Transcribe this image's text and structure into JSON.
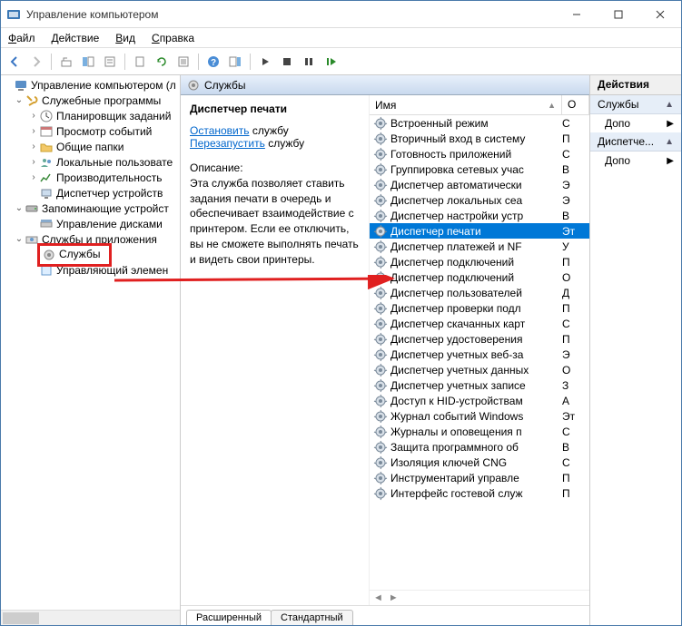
{
  "window": {
    "title": "Управление компьютером"
  },
  "menu": {
    "file": "Файл",
    "action": "Действие",
    "view": "Вид",
    "help": "Справка"
  },
  "tree": {
    "root": "Управление компьютером (л",
    "utilities": "Служебные программы",
    "scheduler": "Планировщик заданий",
    "eventviewer": "Просмотр событий",
    "sharedfolders": "Общие папки",
    "localusers": "Локальные пользовате",
    "performance": "Производительность",
    "devmgr": "Диспетчер устройств",
    "storage": "Запоминающие устройст",
    "diskmgr": "Управление дисками",
    "servicesapps": "Службы и приложения",
    "services": "Службы",
    "wmi": "Управляющий элемен"
  },
  "mid": {
    "header": "Службы",
    "selected_title": "Диспетчер печати",
    "stop_link": "Остановить",
    "stop_suffix": " службу",
    "restart_link": "Перезапустить",
    "restart_suffix": " службу",
    "desc_label": "Описание:",
    "desc_text": "Эта служба позволяет ставить задания печати в очередь и обеспечивает взаимодействие с принтером. Если ее отключить, вы не сможете выполнять печать и видеть свои принтеры."
  },
  "list": {
    "col_name": "Имя",
    "col_o": "О",
    "items": [
      {
        "name": "Встроенный режим",
        "o": "С"
      },
      {
        "name": "Вторичный вход в систему",
        "o": "П"
      },
      {
        "name": "Готовность приложений",
        "o": "С"
      },
      {
        "name": "Группировка сетевых учас",
        "o": "В"
      },
      {
        "name": "Диспетчер автоматически",
        "o": "Э"
      },
      {
        "name": "Диспетчер локальных сеа",
        "o": "Э"
      },
      {
        "name": "Диспетчер настройки устр",
        "o": "В"
      },
      {
        "name": "Диспетчер печати",
        "o": "Эт",
        "selected": true
      },
      {
        "name": "Диспетчер платежей и NF",
        "o": "У"
      },
      {
        "name": "Диспетчер подключений",
        "o": "П"
      },
      {
        "name": "Диспетчер подключений",
        "o": "О"
      },
      {
        "name": "Диспетчер пользователей",
        "o": "Д"
      },
      {
        "name": "Диспетчер проверки подл",
        "o": "П"
      },
      {
        "name": "Диспетчер скачанных карт",
        "o": "С"
      },
      {
        "name": "Диспетчер удостоверения",
        "o": "П"
      },
      {
        "name": "Диспетчер учетных веб-за",
        "o": "Э"
      },
      {
        "name": "Диспетчер учетных данных",
        "o": "О"
      },
      {
        "name": "Диспетчер учетных записе",
        "o": "З"
      },
      {
        "name": "Доступ к HID-устройствам",
        "o": "А"
      },
      {
        "name": "Журнал событий Windows",
        "o": "Эт"
      },
      {
        "name": "Журналы и оповещения п",
        "o": "С"
      },
      {
        "name": "Защита программного об",
        "o": "В"
      },
      {
        "name": "Изоляция ключей CNG",
        "o": "С"
      },
      {
        "name": "Инструментарий управле",
        "o": "П"
      },
      {
        "name": "Интерфейс гостевой служ",
        "o": "П"
      }
    ]
  },
  "tabs": {
    "ext": "Расширенный",
    "std": "Стандартный"
  },
  "actions": {
    "header": "Действия",
    "s1": "Службы",
    "i1": "Допо",
    "s2": "Диспетче...",
    "i2": "Допо"
  }
}
